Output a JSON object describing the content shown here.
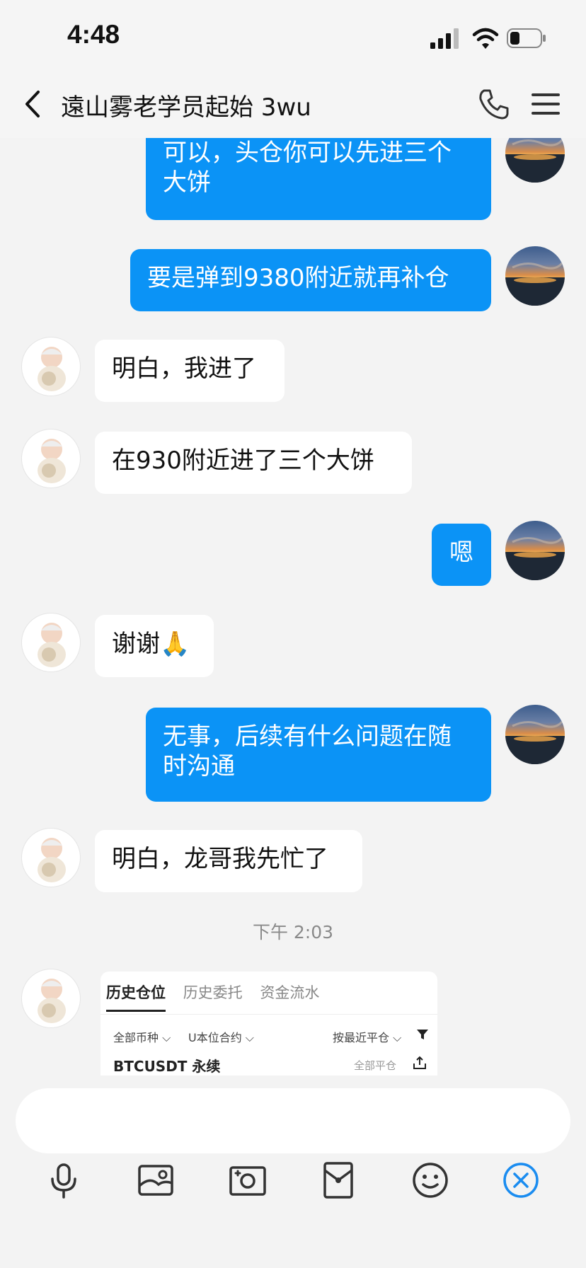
{
  "status_bar": {
    "time": "4:48"
  },
  "header": {
    "title": "遠山雾老学员起始 3wu"
  },
  "messages": [
    {
      "side": "out",
      "text": "可以，头仓你可以先进三个大饼"
    },
    {
      "side": "out",
      "text": "要是弹到9380附近就再补仓"
    },
    {
      "side": "in",
      "text": "明白，我进了"
    },
    {
      "side": "in",
      "text": "在930附近进了三个大饼"
    },
    {
      "side": "out",
      "text": "嗯"
    },
    {
      "side": "in",
      "text": "谢谢🙏"
    },
    {
      "side": "out",
      "text": "无事，后续有什么问题在随时沟通"
    },
    {
      "side": "in",
      "text": "明白，龙哥我先忙了"
    }
  ],
  "timestamp": "下午 2:03",
  "shared_image": {
    "tabs": [
      "历史仓位",
      "历史委托",
      "资金流水"
    ],
    "filters": {
      "coin": "全部币种 ⌵",
      "contract": "U本位合约 ⌵",
      "sort": "按最近平仓 ⌵"
    },
    "symbol": "BTCUSDT 永续",
    "close_all": "全部平仓"
  },
  "input": {
    "placeholder": ""
  },
  "toolbar": {
    "icons": [
      "microphone-icon",
      "image-icon",
      "camera-icon",
      "red-packet-icon",
      "emoji-icon",
      "close-icon"
    ]
  },
  "colors": {
    "outgoing_bubble": "#0b93f6",
    "incoming_bubble": "#ffffff",
    "toolbar_accent": "#1a8cf0"
  }
}
